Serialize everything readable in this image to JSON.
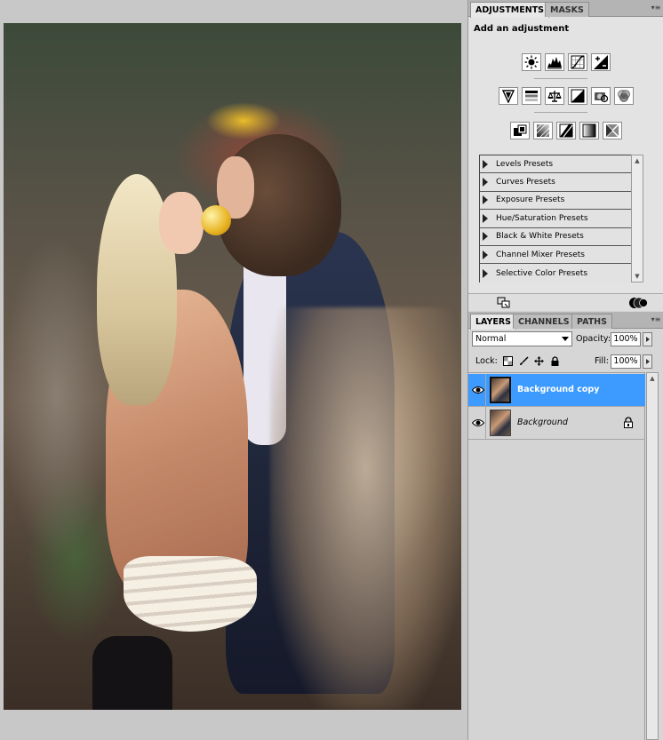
{
  "adjustments_panel": {
    "tabs": [
      "ADJUSTMENTS",
      "MASKS"
    ],
    "title": "Add an adjustment",
    "row1_icons": [
      "brightness-contrast-icon",
      "levels-icon",
      "curves-icon",
      "exposure-icon"
    ],
    "row2_icons": [
      "vibrance-icon",
      "hue-saturation-icon",
      "color-balance-icon",
      "black-white-icon",
      "photo-filter-icon",
      "channel-mixer-icon"
    ],
    "row3_icons": [
      "invert-icon",
      "posterize-icon",
      "threshold-icon",
      "gradient-map-icon",
      "selective-color-icon"
    ],
    "presets": [
      "Levels Presets",
      "Curves Presets",
      "Exposure Presets",
      "Hue/Saturation Presets",
      "Black & White Presets",
      "Channel Mixer Presets",
      "Selective Color Presets"
    ]
  },
  "layers_panel": {
    "tabs": [
      "LAYERS",
      "CHANNELS",
      "PATHS"
    ],
    "blend_mode": "Normal",
    "opacity_label": "Opacity:",
    "opacity_value": "100%",
    "lock_label": "Lock:",
    "fill_label": "Fill:",
    "fill_value": "100%",
    "layers": [
      {
        "name": "Background copy",
        "selected": true,
        "locked": false
      },
      {
        "name": "Background",
        "selected": false,
        "locked": true
      }
    ]
  },
  "colors": {
    "selection": "#3d9bff",
    "panel_bg": "#d6d6d6",
    "canvas_bg": "#c8c8c8"
  }
}
